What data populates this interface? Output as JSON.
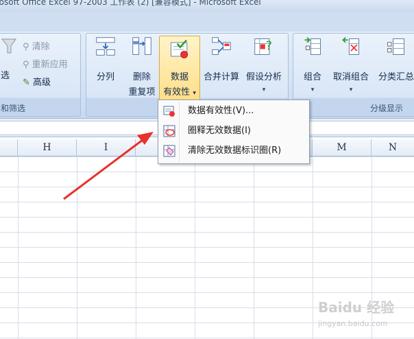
{
  "window": {
    "title": "rosoft Office Excel 97-2003 工作表 (2) [兼容模式] - Microsoft Excel"
  },
  "ribbon": {
    "sort_filter_group": {
      "label": "和筛选",
      "filter_label": "选",
      "clear_label": "清除",
      "reapply_label": "重新应用",
      "advanced_label": "高级"
    },
    "data_tools_group": {
      "text_to_columns": "分列",
      "remove_duplicates_line1": "删除",
      "remove_duplicates_line2": "重复项",
      "data_validation_line1": "数据",
      "data_validation_line2": "有效性",
      "consolidate": "合并计算",
      "what_if": "假设分析"
    },
    "outline_group": {
      "label": "分级显示",
      "group": "组合",
      "ungroup": "取消组合",
      "subtotal": "分类汇总"
    }
  },
  "dropdown": {
    "items": [
      {
        "label": "数据有效性(V)...",
        "icon": "data-validation-icon"
      },
      {
        "label": "圈释无效数据(I)",
        "icon": "circle-invalid-icon"
      },
      {
        "label": "清除无效数据标识圈(R)",
        "icon": "clear-circles-icon"
      }
    ]
  },
  "sheet": {
    "columns": [
      "H",
      "I",
      "",
      "",
      "",
      "M",
      "N"
    ]
  },
  "watermark": {
    "text": "Baidu 经验",
    "url": "jingyan.baidu.com"
  },
  "colors": {
    "arrow": "#e8322b",
    "accent": "#ffd97a"
  }
}
